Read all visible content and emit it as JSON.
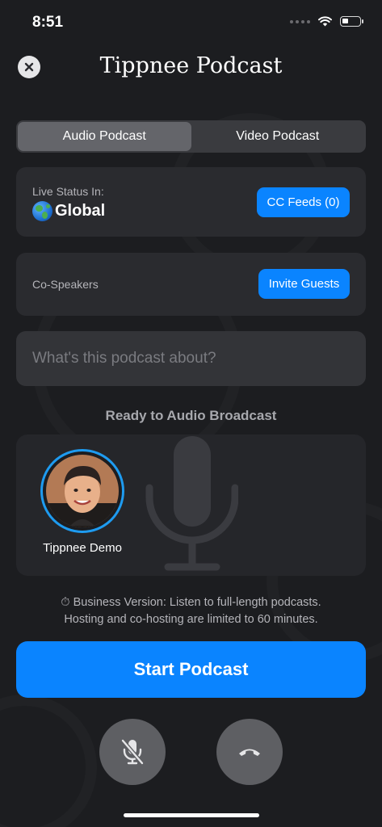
{
  "status_bar": {
    "time": "8:51"
  },
  "header": {
    "title": "Tippnee Podcast"
  },
  "mode_tabs": [
    {
      "label": "Audio Podcast",
      "selected": true
    },
    {
      "label": "Video Podcast",
      "selected": false
    }
  ],
  "live_status": {
    "label": "Live Status In:",
    "value": "Global",
    "icon": "globe-icon",
    "cc_button": "CC Feeds (0)"
  },
  "co_speakers": {
    "label": "Co-Speakers",
    "invite_button": "Invite Guests"
  },
  "about_input": {
    "placeholder": "What's this podcast about?",
    "value": ""
  },
  "stage": {
    "ready_text": "Ready to Audio Broadcast",
    "speaker_name": "Tippnee Demo"
  },
  "notice": {
    "line1": "⏱ Business Version: Listen to full-length podcasts.",
    "line2": "Hosting and co-hosting are limited to 60 minutes."
  },
  "start_button": "Start Podcast",
  "controls": {
    "mute_icon": "mic-off-icon",
    "end_icon": "end-call-icon"
  },
  "colors": {
    "accent": "#0a84ff",
    "background": "#1c1d20",
    "card": "#2a2b2f",
    "avatar_ring": "#1e9bf0"
  }
}
